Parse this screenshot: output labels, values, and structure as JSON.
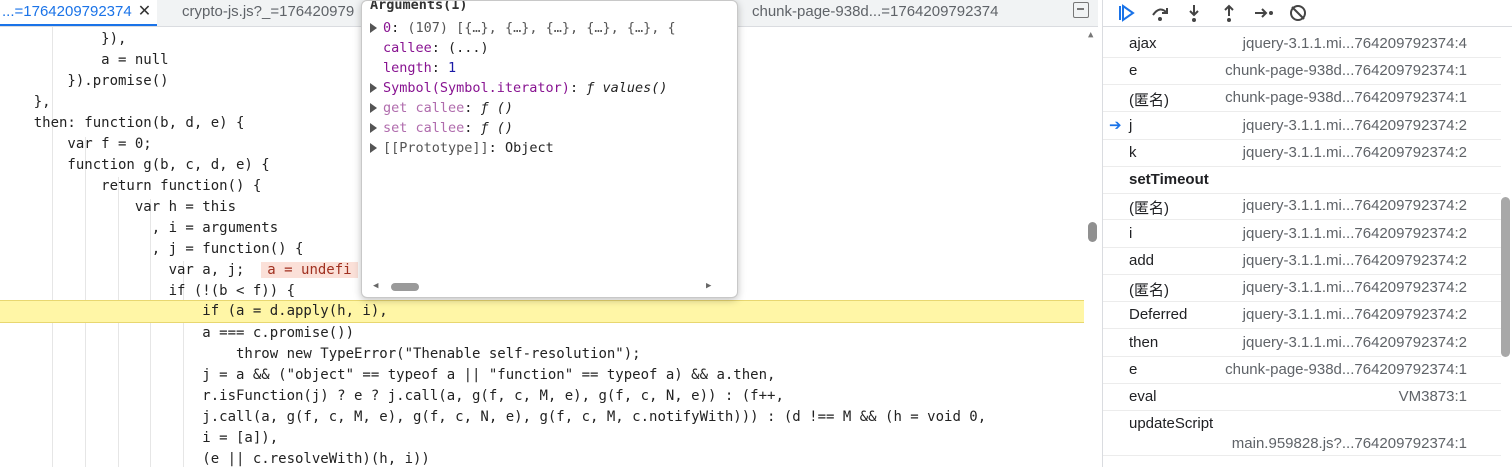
{
  "tabs": [
    {
      "label": "...=1764209792374",
      "active": true
    },
    {
      "label": "crypto-js.js?_=176420979",
      "active": false
    },
    {
      "label": "chunk-page-938d...=1764209792374",
      "active": false
    }
  ],
  "code_lines": [
    "            }),",
    "            a = null",
    "        }).promise()",
    "    },",
    "    then: function(b, d, e) {",
    "        var f = 0;",
    "        function g(b, c, d, e) {",
    "            return function() {",
    "                var h = this",
    "                  , i = arguments",
    "                  , j = function() {",
    "                    var a, j;",
    "                    if (!(b < f)) {",
    "                        if (a = d.apply(h, i),",
    "                        a === c.promise())",
    "                            throw new TypeError(\"Thenable self-resolution\");",
    "                        j = a && (\"object\" == typeof a || \"function\" == typeof a) && a.then,",
    "                        r.isFunction(j) ? e ? j.call(a, g(f, c, M, e), g(f, c, N, e)) : (f++,",
    "                        j.call(a, g(f, c, M, e), g(f, c, N, e), g(f, c, M, c.notifyWith))) : (d !== M && (h = void 0,",
    "                        i = [a]),",
    "                        (e || c.resolveWith)(h, i))"
  ],
  "inline_value": "a = undefi",
  "popover": {
    "title": "Arguments(1)",
    "lines": [
      {
        "expand": true,
        "key": "0",
        "sep": ": ",
        "value": "(107) [{…}, {…}, {…}, {…}, {…}, {"
      },
      {
        "expand": false,
        "key": "callee",
        "sep": ": ",
        "value": "(...)"
      },
      {
        "expand": false,
        "key": "length",
        "sep": ": ",
        "value": "1"
      },
      {
        "expand": true,
        "key": "Symbol(Symbol.iterator)",
        "sep": ": ",
        "value": "ƒ values()"
      },
      {
        "expand": true,
        "key": "get callee",
        "sep": ": ",
        "value": "ƒ ()"
      },
      {
        "expand": true,
        "key": "set callee",
        "sep": ": ",
        "value": "ƒ ()"
      },
      {
        "expand": true,
        "key": "[[Prototype]]",
        "sep": ": ",
        "value": "Object"
      }
    ]
  },
  "toolbar_icons": [
    "resume-icon",
    "step-over-icon",
    "step-into-icon",
    "step-out-icon",
    "step-icon",
    "deactivate-breakpoints-icon"
  ],
  "call_stack": [
    {
      "fn": "ajax",
      "loc": "jquery-3.1.1.mi...764209792374:4"
    },
    {
      "fn": "e",
      "loc": "chunk-page-938d...764209792374:1"
    },
    {
      "fn": "(匿名)",
      "loc": "chunk-page-938d...764209792374:1"
    },
    {
      "fn": "j",
      "loc": "jquery-3.1.1.mi...764209792374:2",
      "current": true
    },
    {
      "fn": "k",
      "loc": "jquery-3.1.1.mi...764209792374:2"
    },
    {
      "fn": "setTimeout",
      "loc": "",
      "group": true
    },
    {
      "fn": "(匿名)",
      "loc": "jquery-3.1.1.mi...764209792374:2"
    },
    {
      "fn": "i",
      "loc": "jquery-3.1.1.mi...764209792374:2"
    },
    {
      "fn": "add",
      "loc": "jquery-3.1.1.mi...764209792374:2"
    },
    {
      "fn": "(匿名)",
      "loc": "jquery-3.1.1.mi...764209792374:2"
    },
    {
      "fn": "Deferred",
      "loc": "jquery-3.1.1.mi...764209792374:2"
    },
    {
      "fn": "then",
      "loc": "jquery-3.1.1.mi...764209792374:2"
    },
    {
      "fn": "e",
      "loc": "chunk-page-938d...764209792374:1"
    },
    {
      "fn": "eval",
      "loc": "VM3873:1"
    },
    {
      "fn": "updateScript",
      "loc": "main.959828.js?...764209792374:1",
      "tall": true
    }
  ]
}
